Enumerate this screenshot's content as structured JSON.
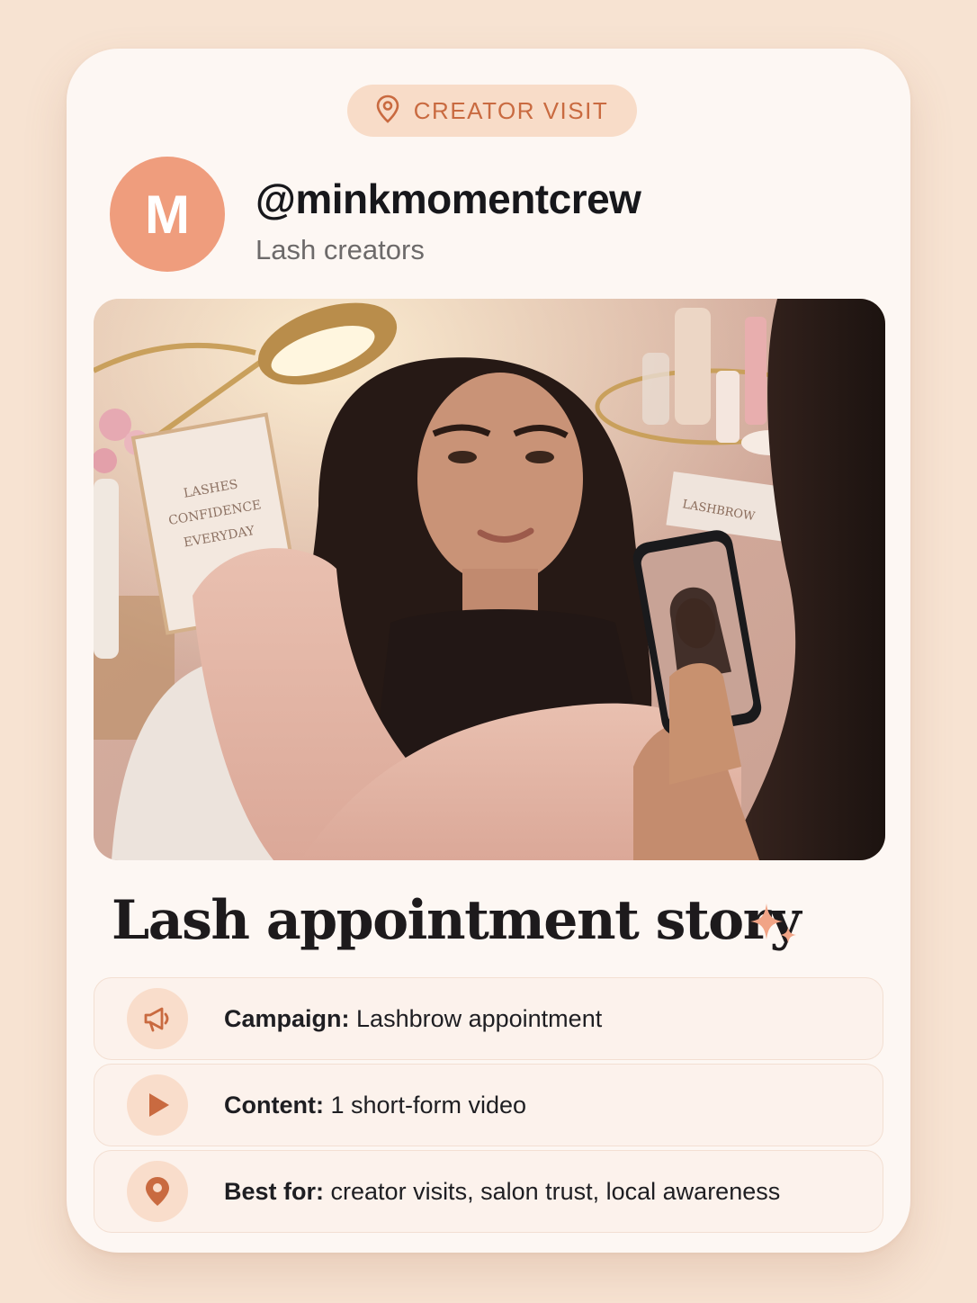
{
  "badge": {
    "icon": "map-pin-icon",
    "label": "CREATOR VISIT"
  },
  "profile": {
    "avatar_letter": "M",
    "handle": "@minkmomentcrew",
    "subtitle": "Lash creators"
  },
  "photo": {
    "sign_lines": [
      "LASHES",
      "CONFIDENCE",
      "EVERYDAY"
    ],
    "box_label": "LASHBROW"
  },
  "headline": "Lash appointment story",
  "details": [
    {
      "icon": "megaphone-icon",
      "label": "Campaign:",
      "value": "Lashbrow appointment"
    },
    {
      "icon": "play-icon",
      "label": "Content:",
      "value": "1 short-form video"
    },
    {
      "icon": "map-pin-icon",
      "label": "Best for:",
      "value": "creator visits, salon trust, local awareness"
    }
  ],
  "colors": {
    "accent": "#c96a40",
    "avatar": "#ef9d7d",
    "pill": "#f8dcc8",
    "background": "#f7e3d2"
  }
}
